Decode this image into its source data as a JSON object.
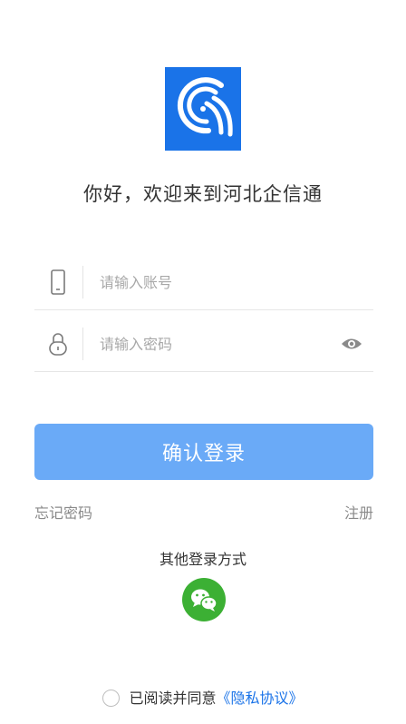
{
  "brand": {
    "logo_icon": "app-logo-icon",
    "logo_color": "#1a73e8"
  },
  "welcome_text": "你好，欢迎来到河北企信通",
  "account_field": {
    "icon": "phone-icon",
    "placeholder": "请输入账号",
    "value": ""
  },
  "password_field": {
    "icon": "lock-icon",
    "placeholder": "请输入密码",
    "value": "",
    "toggle_icon": "eye-icon"
  },
  "login_button": {
    "label": "确认登录",
    "color": "#6aaaf7"
  },
  "links": {
    "forgot_password": "忘记密码",
    "register": "注册"
  },
  "other_login": {
    "title": "其他登录方式",
    "wechat_icon": "wechat-icon",
    "wechat_color": "#3cb034"
  },
  "agreement": {
    "prefix": "已阅读并同意",
    "link": "《隐私协议》",
    "link_color": "#1a73e8"
  }
}
